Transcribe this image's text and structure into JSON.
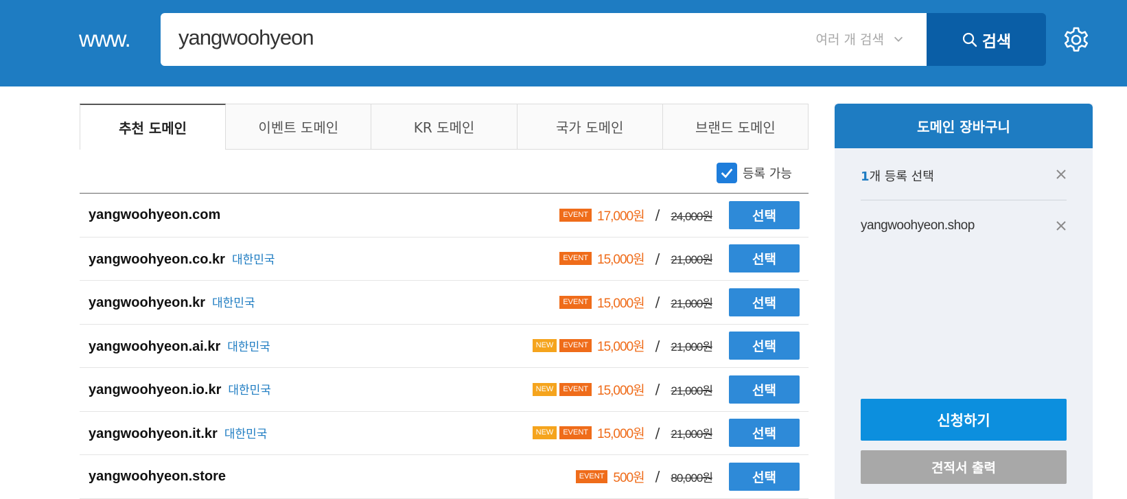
{
  "header": {
    "prefix": "www.",
    "search_value": "yangwoohyeon",
    "multi_search_label": "여러 개 검색",
    "search_button_label": "검색"
  },
  "tabs": [
    {
      "label": "추천 도메인",
      "active": true
    },
    {
      "label": "이벤트 도메인",
      "active": false
    },
    {
      "label": "KR 도메인",
      "active": false
    },
    {
      "label": "국가 도메인",
      "active": false
    },
    {
      "label": "브랜드 도메인",
      "active": false
    }
  ],
  "filter": {
    "label": "등록 가능",
    "checked": true
  },
  "domains": [
    {
      "name": "yangwoohyeon.com",
      "country": "",
      "new": false,
      "event_label": "EVENT",
      "new_label": "",
      "price": "17,000원",
      "original_price": "24,000원",
      "button": "선택"
    },
    {
      "name": "yangwoohyeon.co.kr",
      "country": "대한민국",
      "new": false,
      "event_label": "EVENT",
      "new_label": "",
      "price": "15,000원",
      "original_price": "21,000원",
      "button": "선택"
    },
    {
      "name": "yangwoohyeon.kr",
      "country": "대한민국",
      "new": false,
      "event_label": "EVENT",
      "new_label": "",
      "price": "15,000원",
      "original_price": "21,000원",
      "button": "선택"
    },
    {
      "name": "yangwoohyeon.ai.kr",
      "country": "대한민국",
      "new": true,
      "event_label": "EVENT",
      "new_label": "NEW",
      "price": "15,000원",
      "original_price": "21,000원",
      "button": "선택"
    },
    {
      "name": "yangwoohyeon.io.kr",
      "country": "대한민국",
      "new": true,
      "event_label": "EVENT",
      "new_label": "NEW",
      "price": "15,000원",
      "original_price": "21,000원",
      "button": "선택"
    },
    {
      "name": "yangwoohyeon.it.kr",
      "country": "대한민국",
      "new": true,
      "event_label": "EVENT",
      "new_label": "NEW",
      "price": "15,000원",
      "original_price": "21,000원",
      "button": "선택"
    },
    {
      "name": "yangwoohyeon.store",
      "country": "",
      "new": false,
      "event_label": "EVENT",
      "new_label": "",
      "price": "500원",
      "original_price": "80,000원",
      "button": "선택"
    }
  ],
  "cart": {
    "title": "도메인 장바구니",
    "count": "1",
    "count_suffix": "개 등록 선택",
    "items": [
      "yangwoohyeon.shop"
    ],
    "apply_label": "신청하기",
    "quote_label": "견적서 출력"
  },
  "colors": {
    "header_bg": "#1e7cc2",
    "search_button_bg": "#0a5ea6",
    "accent_blue": "#1e7cc2",
    "event_orange": "#ef6c1a",
    "new_yellow": "#f5a41d",
    "select_button": "#2e8ad8",
    "apply_button": "#0c8fde",
    "quote_button": "#a8a8a8"
  },
  "icons": [
    "search-icon",
    "chevron-down-icon",
    "gear-icon",
    "check-icon",
    "close-icon"
  ]
}
